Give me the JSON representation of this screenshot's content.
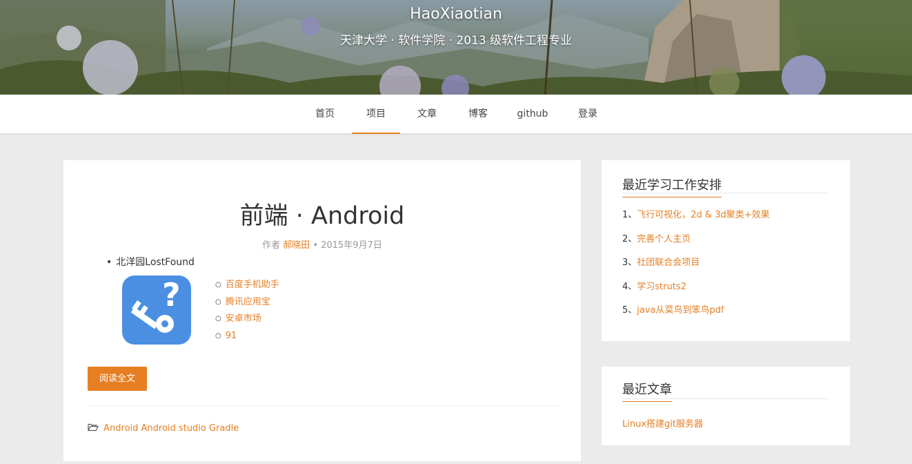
{
  "header": {
    "title": "HaoXiaotian",
    "subtitle": "天津大学 · 软件学院 · 2013 级软件工程专业"
  },
  "nav": {
    "items": [
      {
        "label": "首页"
      },
      {
        "label": "项目",
        "active": true
      },
      {
        "label": "文章"
      },
      {
        "label": "博客"
      },
      {
        "label": "github"
      },
      {
        "label": "登录"
      }
    ]
  },
  "post": {
    "title": "前端 · Android",
    "meta_prefix": "作者",
    "author": "郝晓田",
    "date_text": "• 2015年9月7日",
    "bullet": "北洋园LostFound",
    "app_icon": "lost-found-key-question-icon",
    "links": [
      "百度手机助手",
      "腾讯应用宝",
      "安卓市场",
      "91"
    ],
    "read_more": "阅读全文",
    "tags": "Android Android studio Gradle",
    "tag_icon": "folder-open-icon"
  },
  "sidebar": {
    "schedule": {
      "title": "最近学习工作安排",
      "items": [
        {
          "num": "1、",
          "text": "飞行可视化，2d & 3d聚类+效果"
        },
        {
          "num": "2、",
          "text": "完善个人主页"
        },
        {
          "num": "3、",
          "text": "社团联合会项目"
        },
        {
          "num": "4、",
          "text": "学习struts2"
        },
        {
          "num": "5、",
          "text": "java从菜鸟到笨鸟pdf"
        }
      ]
    },
    "recent": {
      "title": "最近文章",
      "items": [
        "Linux搭建git服务器"
      ]
    }
  },
  "colors": {
    "accent": "#e67e22",
    "icon_bg": "#4a8fe2",
    "page_bg": "#ebebeb"
  }
}
